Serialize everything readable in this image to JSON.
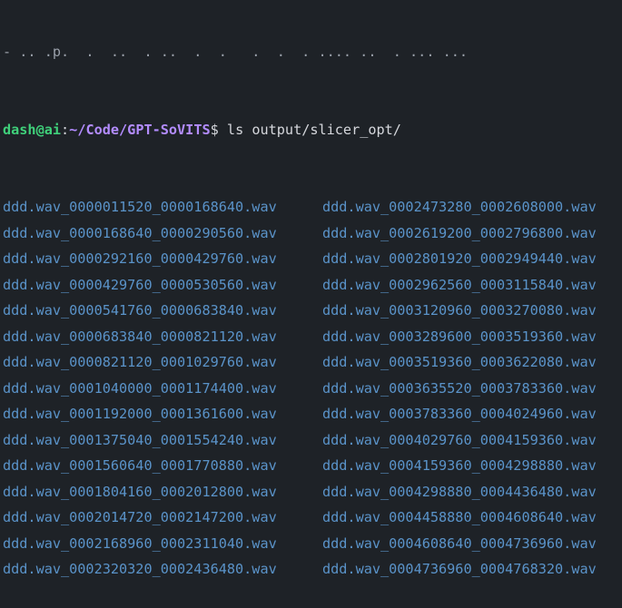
{
  "terminal": {
    "clipped_line": "- .. .p.  .  ..  . ..  .  .   .  .  . .... ..  . ... ...",
    "prompt": {
      "user_host": "dash@ai",
      "separator": ":",
      "path": "~/Code/GPT-SoVITS",
      "symbol": "$",
      "command": " ls output/slicer_opt/"
    },
    "files": [
      [
        "ddd.wav_0000011520_0000168640.wav",
        "ddd.wav_0002473280_0002608000.wav"
      ],
      [
        "ddd.wav_0000168640_0000290560.wav",
        "ddd.wav_0002619200_0002796800.wav"
      ],
      [
        "ddd.wav_0000292160_0000429760.wav",
        "ddd.wav_0002801920_0002949440.wav"
      ],
      [
        "ddd.wav_0000429760_0000530560.wav",
        "ddd.wav_0002962560_0003115840.wav"
      ],
      [
        "ddd.wav_0000541760_0000683840.wav",
        "ddd.wav_0003120960_0003270080.wav"
      ],
      [
        "ddd.wav_0000683840_0000821120.wav",
        "ddd.wav_0003289600_0003519360.wav"
      ],
      [
        "ddd.wav_0000821120_0001029760.wav",
        "ddd.wav_0003519360_0003622080.wav"
      ],
      [
        "ddd.wav_0001040000_0001174400.wav",
        "ddd.wav_0003635520_0003783360.wav"
      ],
      [
        "ddd.wav_0001192000_0001361600.wav",
        "ddd.wav_0003783360_0004024960.wav"
      ],
      [
        "ddd.wav_0001375040_0001554240.wav",
        "ddd.wav_0004029760_0004159360.wav"
      ],
      [
        "ddd.wav_0001560640_0001770880.wav",
        "ddd.wav_0004159360_0004298880.wav"
      ],
      [
        "ddd.wav_0001804160_0002012800.wav",
        "ddd.wav_0004298880_0004436480.wav"
      ],
      [
        "ddd.wav_0002014720_0002147200.wav",
        "ddd.wav_0004458880_0004608640.wav"
      ],
      [
        "ddd.wav_0002168960_0002311040.wav",
        "ddd.wav_0004608640_0004736960.wav"
      ],
      [
        "ddd.wav_0002320320_0002436480.wav",
        "ddd.wav_0004736960_0004768320.wav"
      ]
    ],
    "colors": {
      "background": "#1e2227",
      "text": "#d5d7dc",
      "user_host": "#3fd07a",
      "path": "#b38cff",
      "file": "#5a93c9"
    }
  }
}
